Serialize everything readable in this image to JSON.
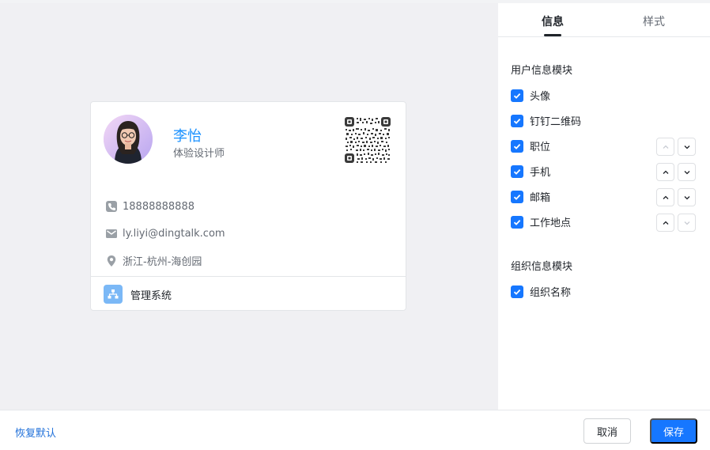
{
  "card": {
    "name": "李怡",
    "title": "体验设计师",
    "phone": "18888888888",
    "email": "ly.liyi@dingtalk.com",
    "location": "浙江-杭州-海创园",
    "org_name": "管理系统"
  },
  "tabs": {
    "info": "信息",
    "style": "样式"
  },
  "user_section": {
    "title": "用户信息模块",
    "items": [
      {
        "label": "头像",
        "checked": true
      },
      {
        "label": "钉钉二维码",
        "checked": true
      },
      {
        "label": "职位",
        "checked": true
      },
      {
        "label": "手机",
        "checked": true
      },
      {
        "label": "邮箱",
        "checked": true
      },
      {
        "label": "工作地点",
        "checked": true
      }
    ]
  },
  "org_section": {
    "title": "组织信息模块",
    "items": [
      {
        "label": "组织名称",
        "checked": true
      }
    ]
  },
  "footer": {
    "reset": "恢复默认",
    "cancel": "取消",
    "save": "保存"
  },
  "colors": {
    "primary": "#1677ff",
    "name_blue": "#1890ff",
    "link": "#1e6fd9"
  }
}
